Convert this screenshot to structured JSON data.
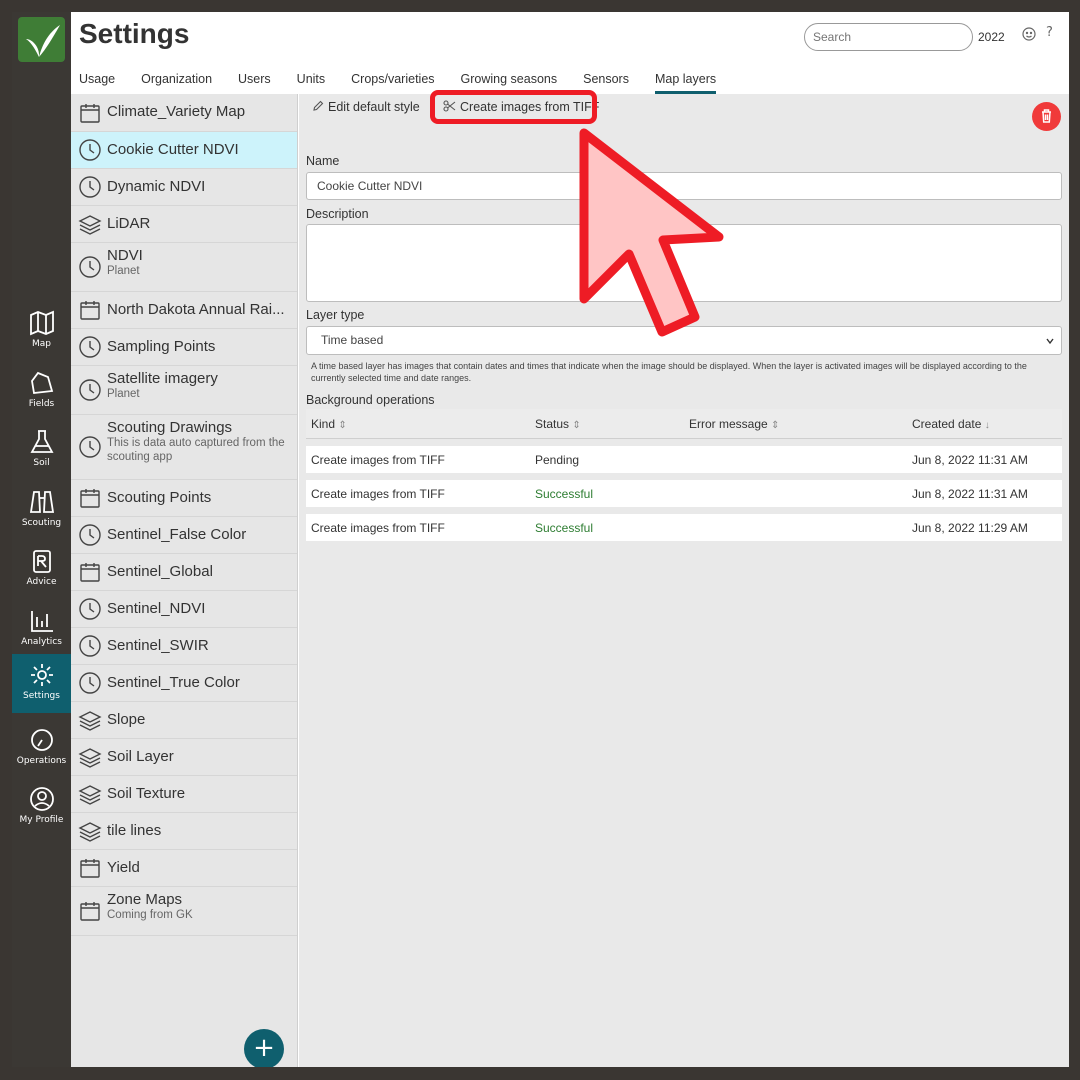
{
  "app": {
    "title": "Settings",
    "search_placeholder": "Search",
    "year": "2022",
    "help": "?"
  },
  "tabs": [
    {
      "label": "Usage"
    },
    {
      "label": "Organization"
    },
    {
      "label": "Users"
    },
    {
      "label": "Units"
    },
    {
      "label": "Crops/varieties"
    },
    {
      "label": "Growing seasons"
    },
    {
      "label": "Sensors"
    },
    {
      "label": "Map layers",
      "active": true
    }
  ],
  "rail": [
    {
      "label": "Map",
      "icon": "map-icon"
    },
    {
      "label": "Fields",
      "icon": "field-icon"
    },
    {
      "label": "Soil",
      "icon": "flask-icon"
    },
    {
      "label": "Scouting",
      "icon": "binoculars-icon"
    },
    {
      "label": "Advice",
      "icon": "prescription-icon"
    },
    {
      "label": "Analytics",
      "icon": "chart-icon"
    },
    {
      "label": "Settings",
      "icon": "gear-icon",
      "active": true
    },
    {
      "label": "Operations",
      "icon": "gauge-icon"
    },
    {
      "label": "My Profile",
      "icon": "user-icon"
    }
  ],
  "layers": [
    {
      "name": "Climate_Variety Map",
      "icon": "calendar-icon"
    },
    {
      "name": "Cookie Cutter NDVI",
      "icon": "clock-icon",
      "selected": true
    },
    {
      "name": "Dynamic NDVI",
      "icon": "clock-icon"
    },
    {
      "name": "LiDAR",
      "icon": "layers-icon"
    },
    {
      "name": "NDVI",
      "sub": "Planet",
      "icon": "clock-icon"
    },
    {
      "name": "North Dakota Annual Rai...",
      "icon": "calendar-icon"
    },
    {
      "name": "Sampling Points",
      "icon": "clock-icon"
    },
    {
      "name": "Satellite imagery",
      "sub": "Planet",
      "icon": "clock-icon"
    },
    {
      "name": "Scouting Drawings",
      "sub": "This is data auto captured from the scouting app",
      "icon": "clock-icon"
    },
    {
      "name": "Scouting Points",
      "icon": "calendar-icon"
    },
    {
      "name": "Sentinel_False Color",
      "icon": "clock-icon"
    },
    {
      "name": "Sentinel_Global",
      "icon": "calendar-icon"
    },
    {
      "name": "Sentinel_NDVI",
      "icon": "clock-icon"
    },
    {
      "name": "Sentinel_SWIR",
      "icon": "clock-icon"
    },
    {
      "name": "Sentinel_True Color",
      "icon": "clock-icon"
    },
    {
      "name": "Slope",
      "icon": "layers-icon"
    },
    {
      "name": "Soil Layer",
      "icon": "layers-icon"
    },
    {
      "name": "Soil Texture",
      "icon": "layers-icon"
    },
    {
      "name": "tile lines",
      "icon": "layers-icon"
    },
    {
      "name": "Yield",
      "icon": "calendar-icon"
    },
    {
      "name": "Zone Maps",
      "sub": "Coming from GK",
      "icon": "calendar-icon"
    }
  ],
  "add_button": "+",
  "toolbar": {
    "edit_style": "Edit default style",
    "create_images": "Create images from TIFF"
  },
  "form": {
    "name_label": "Name",
    "name_value": "Cookie Cutter NDVI",
    "description_label": "Description",
    "description_value": "",
    "layer_type_label": "Layer type",
    "layer_type_value": "Time based",
    "layer_type_hint": "A time based layer has images that contain dates and times that indicate when the image should be displayed. When the layer is activated images will be displayed according to the currently selected time and date ranges."
  },
  "operations": {
    "title": "Background operations",
    "columns": [
      "Kind",
      "Status",
      "Error message",
      "Created date"
    ],
    "rows": [
      {
        "kind": "Create images from TIFF",
        "status": "Pending",
        "error": "",
        "created": "Jun 8, 2022 11:31 AM"
      },
      {
        "kind": "Create images from TIFF",
        "status": "Successful",
        "error": "",
        "created": "Jun 8, 2022 11:31 AM"
      },
      {
        "kind": "Create images from TIFF",
        "status": "Successful",
        "error": "",
        "created": "Jun 8, 2022 11:29 AM"
      }
    ]
  },
  "colors": {
    "accent": "#0f5f6e",
    "rail": "#3b3834",
    "selected": "#cdf3fb",
    "delete": "#f03a3a",
    "annotation": "#ee1c25",
    "success": "#2e7d32"
  }
}
